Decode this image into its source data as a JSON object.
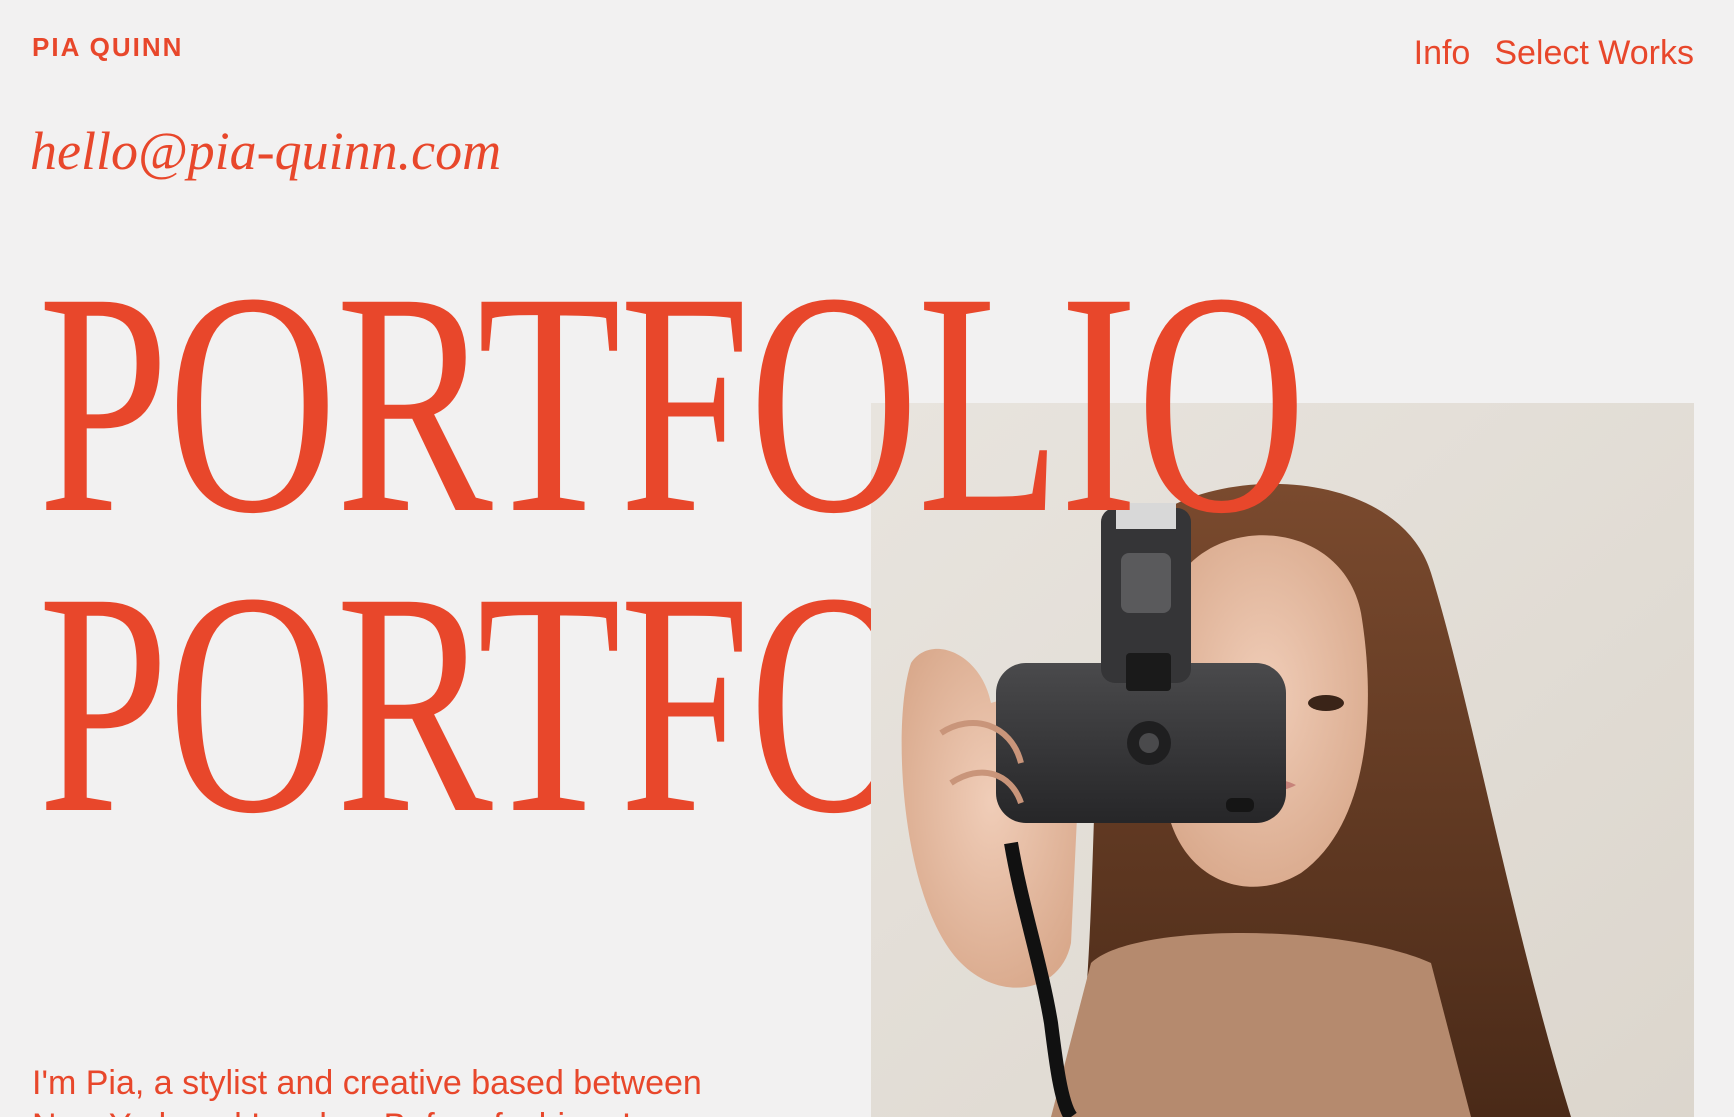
{
  "header": {
    "brand": "PIA QUINN",
    "nav": [
      {
        "label": "Info"
      },
      {
        "label": "Select Works"
      }
    ]
  },
  "contact": {
    "email": "hello@pia-quinn.com"
  },
  "hero": {
    "line1": "PORTFOLIO",
    "line2": "PORTFOLIO"
  },
  "intro": {
    "text": "I'm Pia, a stylist and creative based between New York and London. Before fashion, I"
  },
  "colors": {
    "background": "#f2f1f1",
    "accent": "#e8472b"
  },
  "photo": {
    "subject": "woman holding a compact film camera over one eye"
  }
}
